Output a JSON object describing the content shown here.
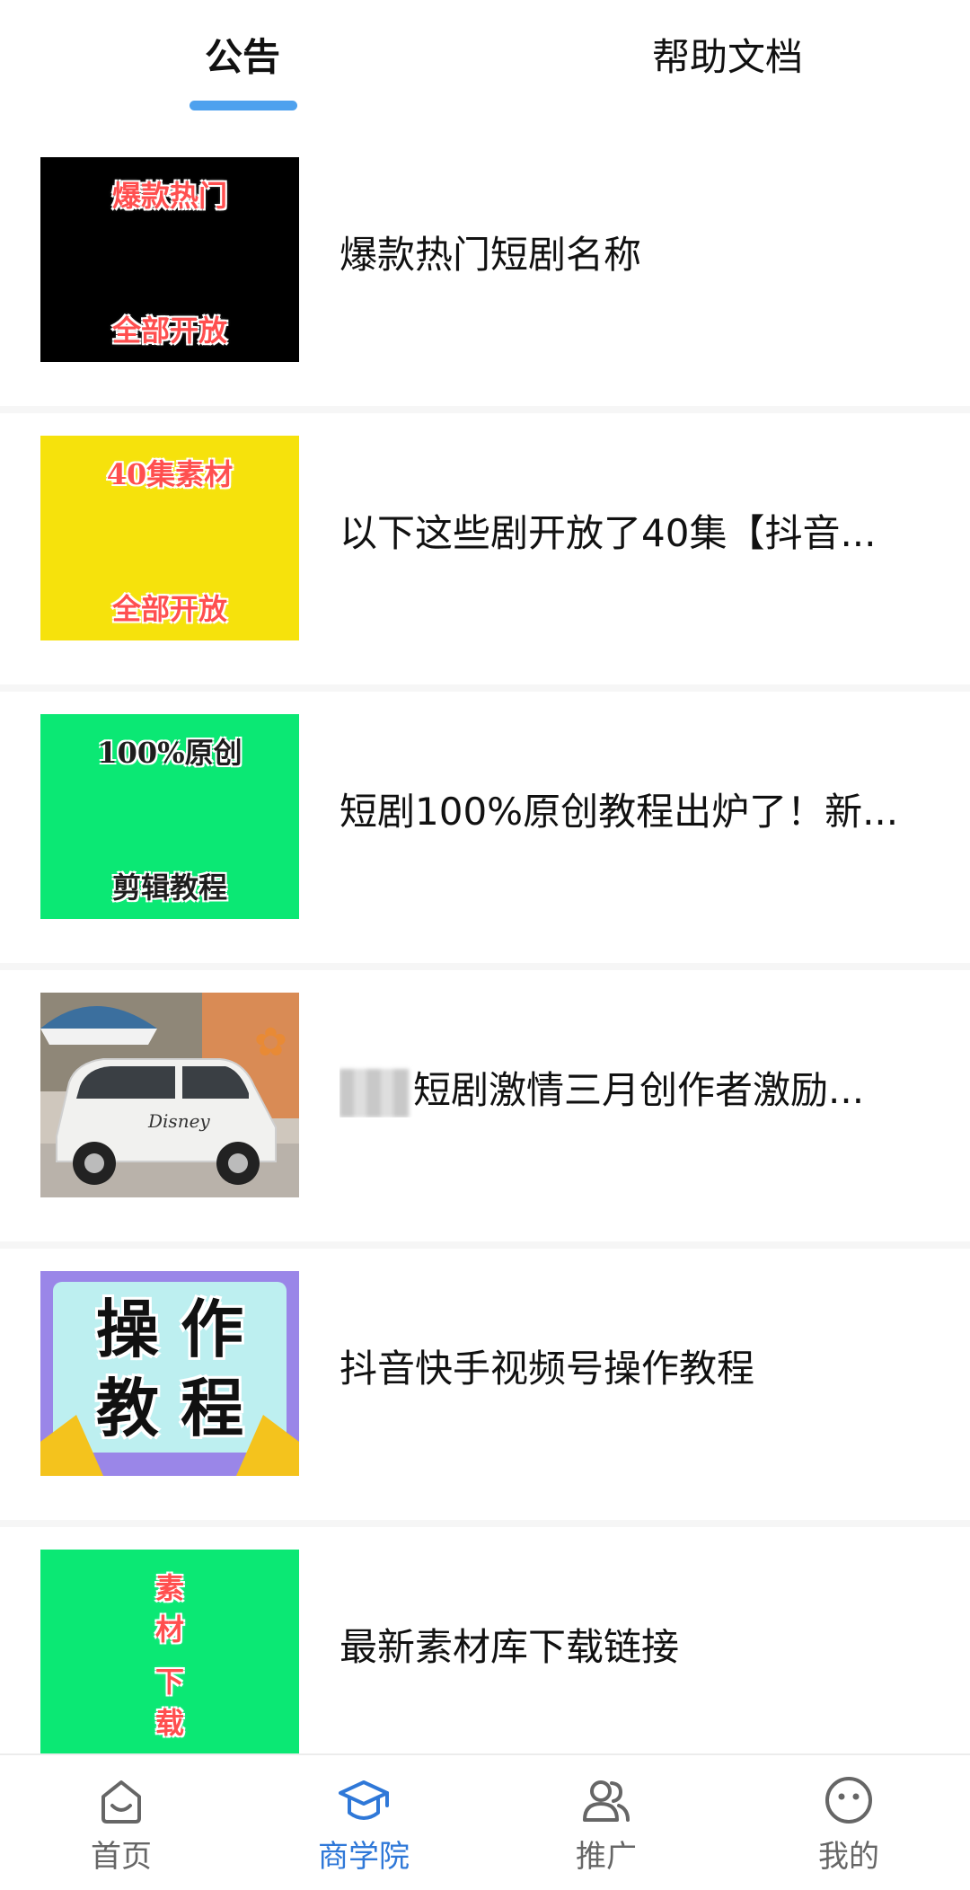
{
  "tabs": [
    {
      "label": "公告",
      "active": true
    },
    {
      "label": "帮助文档",
      "active": false
    }
  ],
  "accent_color": "#4ea1ee",
  "items": [
    {
      "thumb": {
        "style": "black",
        "top": "爆款热门",
        "bottom": "全部开放"
      },
      "title": "爆款热门短剧名称"
    },
    {
      "thumb": {
        "style": "yellow",
        "top": "40集素材",
        "bottom": "全部开放"
      },
      "title": "以下这些剧开放了40集【抖音..."
    },
    {
      "thumb": {
        "style": "green",
        "top": "100%原创",
        "bottom": "剪辑教程"
      },
      "title": "短剧100%原创教程出炉了！新..."
    },
    {
      "thumb": {
        "style": "photo",
        "brand": "Disney"
      },
      "title": "短剧激情三月创作者激励..."
    },
    {
      "thumb": {
        "style": "illustration",
        "row1": "操 作",
        "row2": "教 程"
      },
      "title": "抖音快手视频号操作教程"
    },
    {
      "thumb": {
        "style": "green",
        "top": "素材",
        "bottom": "下载"
      },
      "title": "最新素材库下载链接"
    }
  ],
  "bottom_nav": [
    {
      "label": "首页",
      "icon": "home-icon",
      "active": false
    },
    {
      "label": "商学院",
      "icon": "graduation-cap-icon",
      "active": true
    },
    {
      "label": "推广",
      "icon": "users-icon",
      "active": false
    },
    {
      "label": "我的",
      "icon": "smiley-face-icon",
      "active": false
    }
  ],
  "nav_active_color": "#2f78d8",
  "nav_inactive_color": "#666666"
}
